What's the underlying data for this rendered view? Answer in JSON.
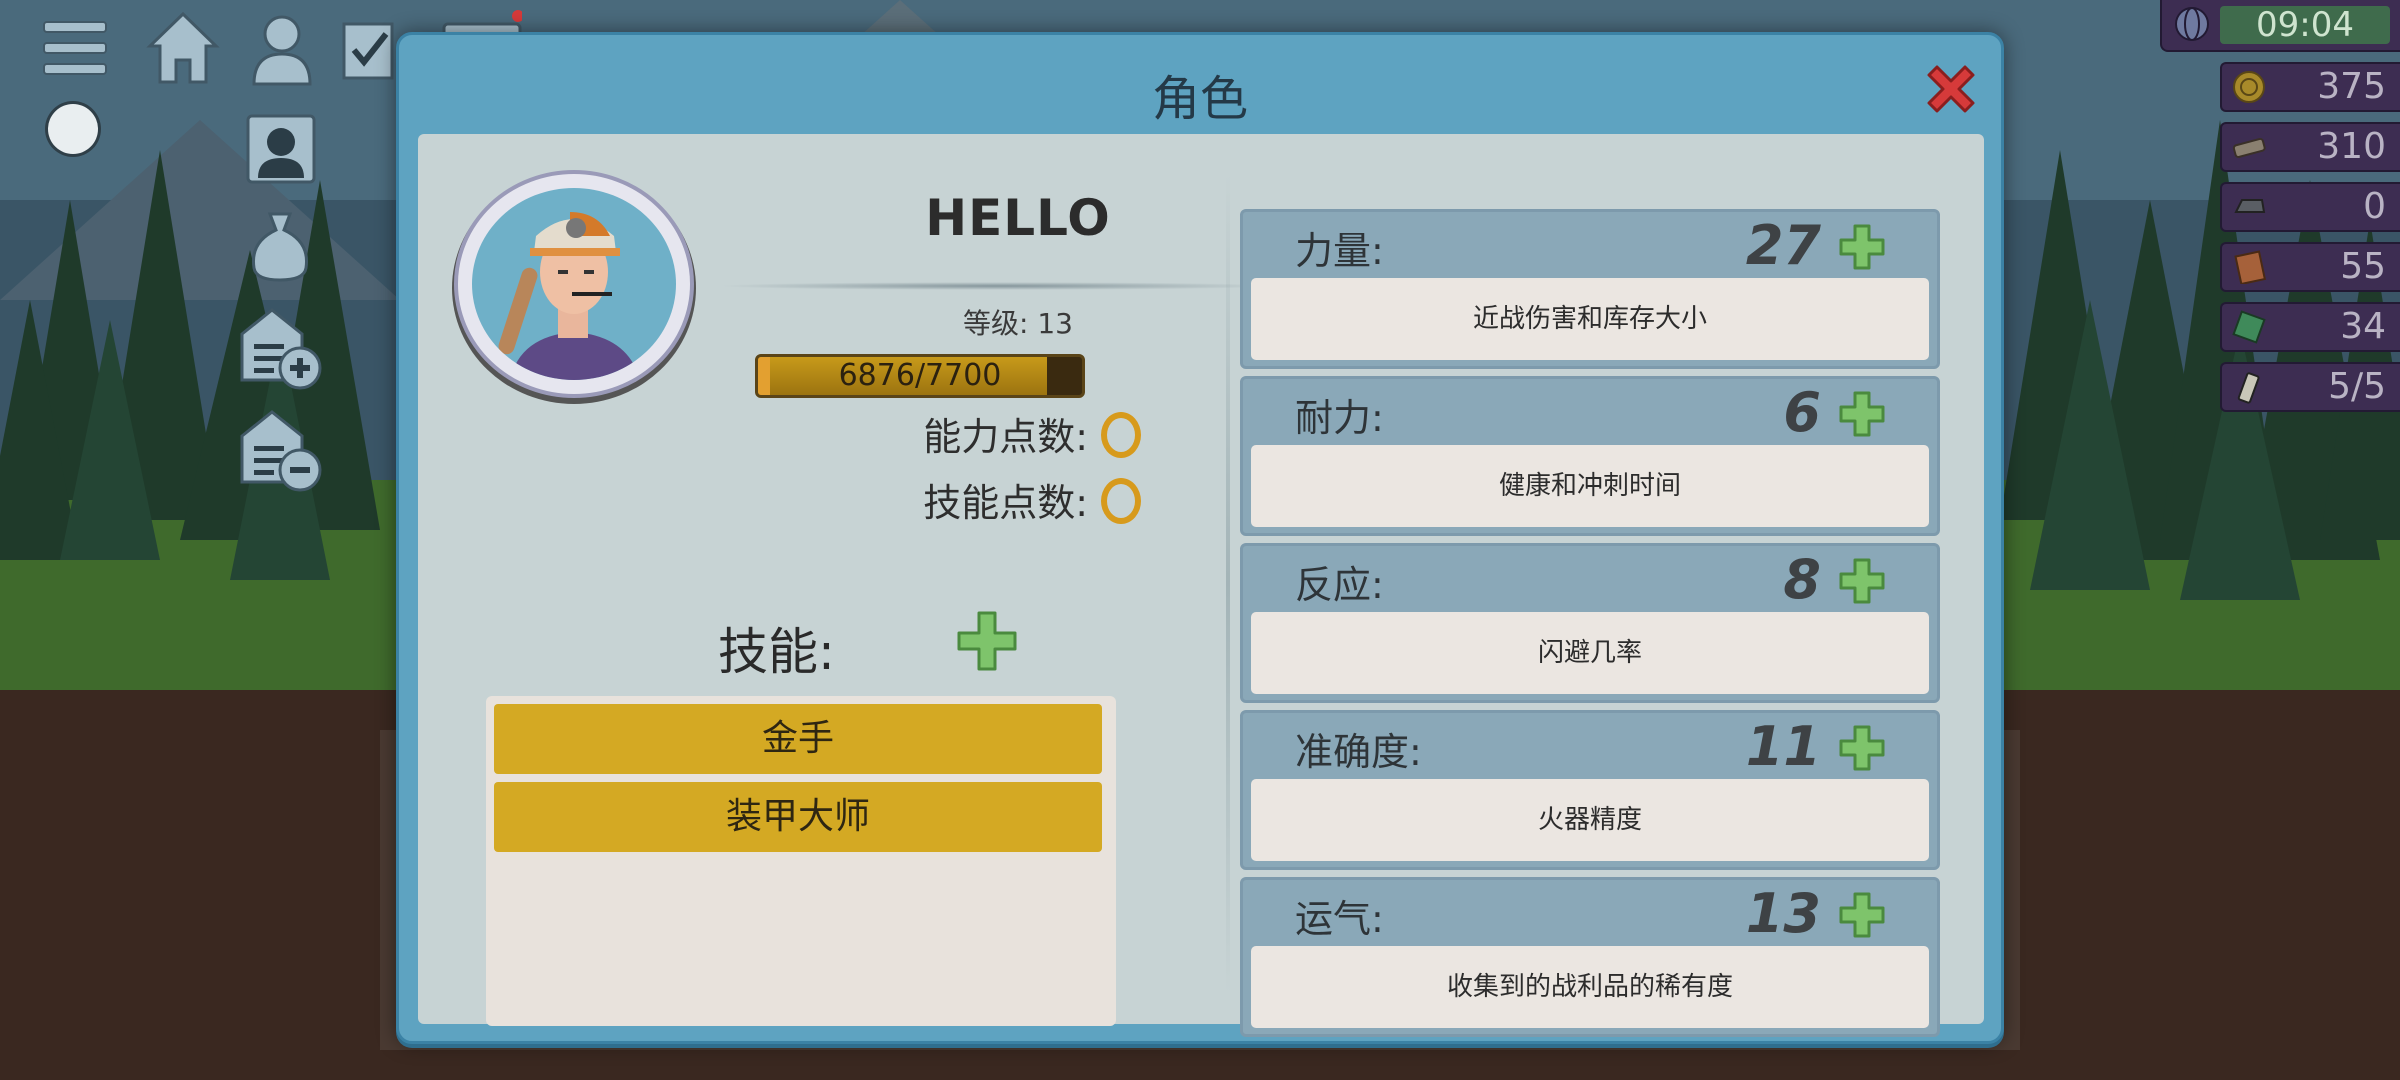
{
  "hud_left": {
    "icons": [
      "menu-icon",
      "home-icon",
      "profile-icon",
      "tasks-icon",
      "radio-icon",
      "character-card-icon",
      "loot-bag-icon",
      "add-base-icon",
      "remove-base-icon"
    ]
  },
  "resources": {
    "clock": "09:04",
    "items": [
      {
        "icon": "coin-icon",
        "value": "375"
      },
      {
        "icon": "scrap-icon",
        "value": "310"
      },
      {
        "icon": "ingot-icon",
        "value": "0"
      },
      {
        "icon": "book-icon",
        "value": "55"
      },
      {
        "icon": "circuit-icon",
        "value": "34"
      },
      {
        "icon": "battery-icon",
        "value": "5/5"
      }
    ]
  },
  "modal": {
    "title": "角色",
    "close_icon": "close-icon"
  },
  "character": {
    "name": "HELLO",
    "level_label": "等级:",
    "level_value": "13",
    "xp_text": "6876/7700",
    "xp_fraction": 0.893,
    "ability_points_label": "能力点数:",
    "ability_points_value": 0,
    "skill_points_label": "技能点数:",
    "skill_points_value": 0
  },
  "skills": {
    "label": "技能:",
    "items": [
      "金手",
      "装甲大师"
    ]
  },
  "stats": [
    {
      "name": "力量:",
      "value": "27",
      "desc": "近战伤害和库存大小"
    },
    {
      "name": "耐力:",
      "value": "6",
      "desc": "健康和冲刺时间"
    },
    {
      "name": "反应:",
      "value": "8",
      "desc": "闪避几率"
    },
    {
      "name": "准确度:",
      "value": "11",
      "desc": "火器精度"
    },
    {
      "name": "运气:",
      "value": "13",
      "desc": "收集到的战利品的稀有度"
    }
  ],
  "colors": {
    "modal_frame": "#5ea3c1",
    "panel": "#c7d3d4",
    "stat_header": "#8aa8b8",
    "skill_item": "#d4a923",
    "plus_green": "#7ec46b",
    "close_red": "#d63a3a",
    "xp_gold": "#b88a15"
  }
}
